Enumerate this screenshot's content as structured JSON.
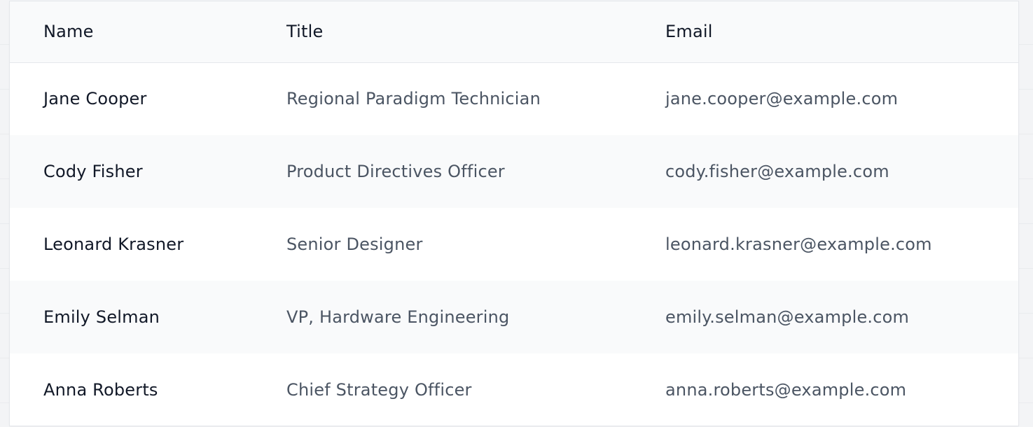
{
  "table": {
    "headers": {
      "name": "Name",
      "title": "Title",
      "email": "Email"
    },
    "rows": [
      {
        "name": "Jane Cooper",
        "title": "Regional Paradigm Technician",
        "email": "jane.cooper@example.com"
      },
      {
        "name": "Cody Fisher",
        "title": "Product Directives Officer",
        "email": "cody.fisher@example.com"
      },
      {
        "name": "Leonard Krasner",
        "title": "Senior Designer",
        "email": "leonard.krasner@example.com"
      },
      {
        "name": "Emily Selman",
        "title": "VP, Hardware Engineering",
        "email": "emily.selman@example.com"
      },
      {
        "name": "Anna Roberts",
        "title": "Chief Strategy Officer",
        "email": "anna.roberts@example.com"
      }
    ]
  }
}
